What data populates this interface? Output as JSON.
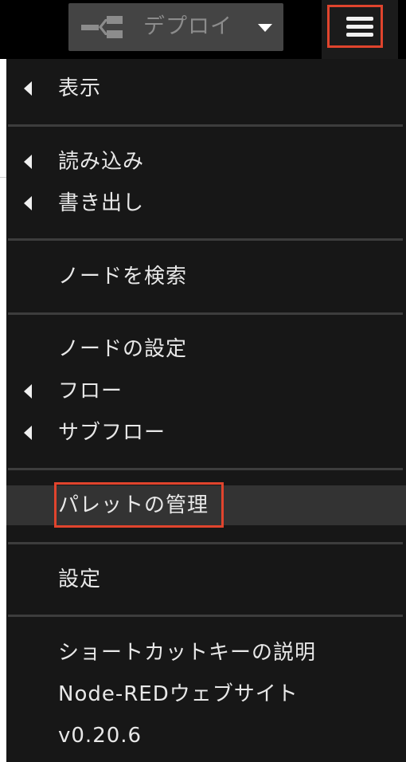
{
  "header": {
    "deploy_label": "デプロイ",
    "deploy_icon": "deploy-flow-icon",
    "menu_icon": "hamburger-icon"
  },
  "menu": {
    "view": "表示",
    "import": "読み込み",
    "export": "書き出し",
    "search": "ノードを検索",
    "configuration_nodes": "ノードの設定",
    "flows": "フロー",
    "subflows": "サブフロー",
    "manage_palette": "パレットの管理",
    "settings": "設定",
    "keyboard_shortcuts": "ショートカットキーの説明",
    "website": "Node-REDウェブサイト",
    "version": "v0.20.6"
  },
  "colors": {
    "highlight": "#e0442d",
    "menu_background": "#171717",
    "hover_background": "#333333"
  }
}
